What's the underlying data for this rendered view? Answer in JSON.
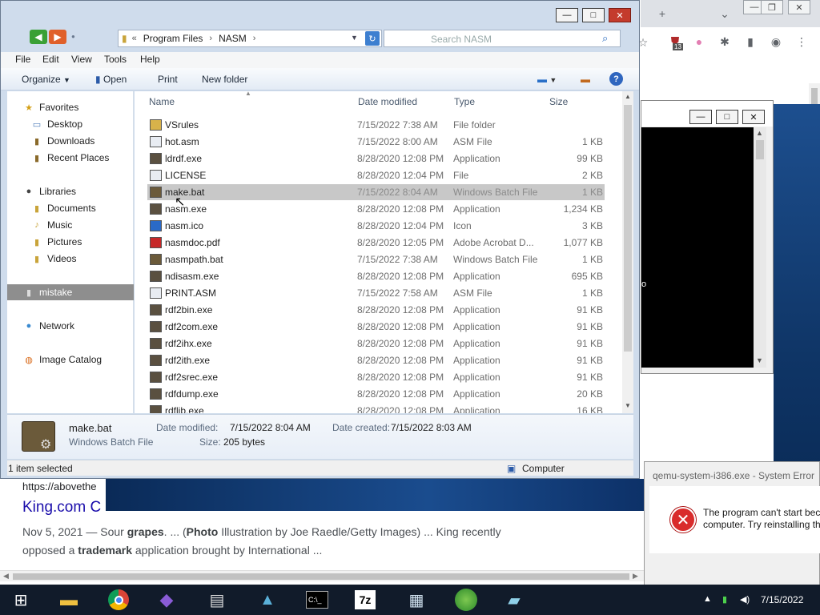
{
  "explorer": {
    "address": {
      "prefix": "«",
      "crumbs": [
        "Program Files",
        "NASM"
      ]
    },
    "search_placeholder": "Search NASM",
    "menu": [
      "File",
      "Edit",
      "View",
      "Tools",
      "Help"
    ],
    "commands": {
      "organize": "Organize",
      "open": "Open",
      "print": "Print",
      "new_folder": "New folder"
    },
    "nav": {
      "favorites": "Favorites",
      "desktop": "Desktop",
      "downloads": "Downloads",
      "recent": "Recent Places",
      "libraries": "Libraries",
      "documents": "Documents",
      "music": "Music",
      "pictures": "Pictures",
      "videos": "Videos",
      "mistake": "mistake",
      "network": "Network",
      "image_catalog": "Image Catalog"
    },
    "columns": {
      "name": "Name",
      "date": "Date modified",
      "type": "Type",
      "size": "Size"
    },
    "files": [
      {
        "name": "VSrules",
        "date": "7/15/2022 7:38 AM",
        "type": "File folder",
        "size": "",
        "icon": "folder"
      },
      {
        "name": "hot.asm",
        "date": "7/15/2022 8:00 AM",
        "type": "ASM File",
        "size": "1 KB",
        "icon": "doc"
      },
      {
        "name": "ldrdf.exe",
        "date": "8/28/2020 12:08 PM",
        "type": "Application",
        "size": "99 KB",
        "icon": "exe"
      },
      {
        "name": "LICENSE",
        "date": "8/28/2020 12:04 PM",
        "type": "File",
        "size": "2 KB",
        "icon": "doc"
      },
      {
        "name": "make.bat",
        "date": "7/15/2022 8:04 AM",
        "type": "Windows Batch File",
        "size": "1 KB",
        "icon": "bat"
      },
      {
        "name": "nasm.exe",
        "date": "8/28/2020 12:08 PM",
        "type": "Application",
        "size": "1,234 KB",
        "icon": "exe"
      },
      {
        "name": "nasm.ico",
        "date": "8/28/2020 12:04 PM",
        "type": "Icon",
        "size": "3 KB",
        "icon": "ico"
      },
      {
        "name": "nasmdoc.pdf",
        "date": "8/28/2020 12:05 PM",
        "type": "Adobe Acrobat D...",
        "size": "1,077 KB",
        "icon": "pdf"
      },
      {
        "name": "nasmpath.bat",
        "date": "7/15/2022 7:38 AM",
        "type": "Windows Batch File",
        "size": "1 KB",
        "icon": "bat"
      },
      {
        "name": "ndisasm.exe",
        "date": "8/28/2020 12:08 PM",
        "type": "Application",
        "size": "695 KB",
        "icon": "exe"
      },
      {
        "name": "PRINT.ASM",
        "date": "7/15/2022 7:58 AM",
        "type": "ASM File",
        "size": "1 KB",
        "icon": "doc"
      },
      {
        "name": "rdf2bin.exe",
        "date": "8/28/2020 12:08 PM",
        "type": "Application",
        "size": "91 KB",
        "icon": "exe"
      },
      {
        "name": "rdf2com.exe",
        "date": "8/28/2020 12:08 PM",
        "type": "Application",
        "size": "91 KB",
        "icon": "exe"
      },
      {
        "name": "rdf2ihx.exe",
        "date": "8/28/2020 12:08 PM",
        "type": "Application",
        "size": "91 KB",
        "icon": "exe"
      },
      {
        "name": "rdf2ith.exe",
        "date": "8/28/2020 12:08 PM",
        "type": "Application",
        "size": "91 KB",
        "icon": "exe"
      },
      {
        "name": "rdf2srec.exe",
        "date": "8/28/2020 12:08 PM",
        "type": "Application",
        "size": "91 KB",
        "icon": "exe"
      },
      {
        "name": "rdfdump.exe",
        "date": "8/28/2020 12:08 PM",
        "type": "Application",
        "size": "20 KB",
        "icon": "exe"
      },
      {
        "name": "rdflib.exe",
        "date": "8/28/2020 12:08 PM",
        "type": "Application",
        "size": "16 KB",
        "icon": "exe"
      }
    ],
    "selected_index": 4,
    "details": {
      "name": "make.bat",
      "type": "Windows Batch File",
      "modified_label": "Date modified:",
      "modified": "7/15/2022 8:04 AM",
      "created_label": "Date created:",
      "created": "7/15/2022 8:03 AM",
      "size_label": "Size:",
      "size": "205 bytes"
    },
    "status": {
      "selection": "1 item selected",
      "location": "Computer"
    }
  },
  "browser": {
    "result_url": "https://abovethe",
    "result_title": "King.com C",
    "snippet_line1_pre": "Nov 5, 2021 — Sour ",
    "snippet_b1": "grapes",
    "snippet_mid1": ". ... (",
    "snippet_b2": "Photo",
    "snippet_mid2": " Illustration by Joe Raedle/Getty Images) ... King recently",
    "snippet_line2_pre": "opposed a ",
    "snippet_b3": "trademark",
    "snippet_line2_post": " application brought by International ...",
    "ext_badge": "13",
    "right_fragment": "Yo"
  },
  "qemu": {
    "screen_fragment": "o"
  },
  "error_dialog": {
    "title": "qemu-system-i386.exe - System Error",
    "line1": "The program can't start bec",
    "line2": "computer. Try reinstalling th"
  },
  "taskbar": {
    "clock": "7/15/2022"
  },
  "colors": {
    "explorer_frame": "#cfdcec",
    "selection": "#c8c8c8",
    "link": "#1a0dab",
    "taskbar": "#111b2a"
  }
}
